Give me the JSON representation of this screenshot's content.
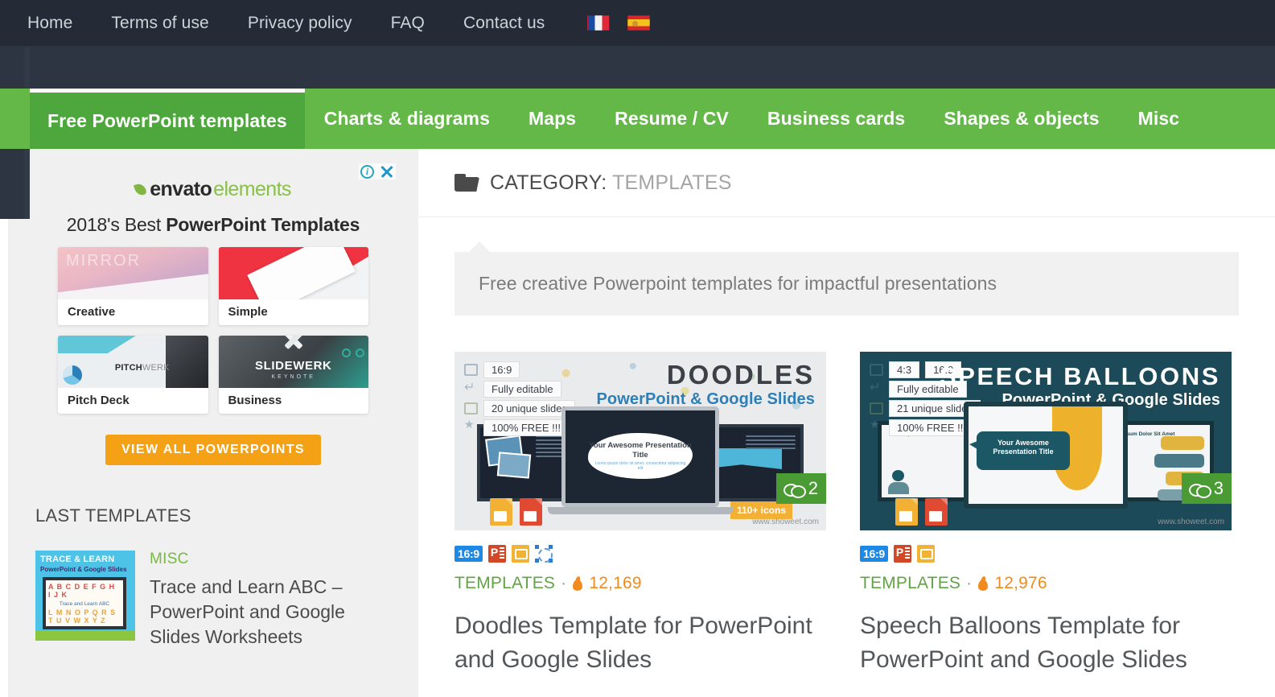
{
  "topnav": {
    "links": [
      {
        "label": "Home"
      },
      {
        "label": "Terms of use"
      },
      {
        "label": "Privacy policy"
      },
      {
        "label": "FAQ"
      },
      {
        "label": "Contact us"
      }
    ],
    "flags": [
      {
        "name": "flag-france-icon",
        "title": "Français"
      },
      {
        "name": "flag-spain-icon",
        "title": "Español"
      }
    ]
  },
  "mainmenu": {
    "items": [
      {
        "label": "Free PowerPoint templates",
        "active": true
      },
      {
        "label": "Charts & diagrams",
        "active": false
      },
      {
        "label": "Maps",
        "active": false
      },
      {
        "label": "Resume / CV",
        "active": false
      },
      {
        "label": "Business cards",
        "active": false
      },
      {
        "label": "Shapes & objects",
        "active": false
      },
      {
        "label": "Misc",
        "active": false
      }
    ],
    "active_bg": "#4da73c",
    "bar_bg": "#63b847"
  },
  "sidebar": {
    "ad": {
      "info_icon": "info-icon",
      "close_icon": "close-icon",
      "brand_first": "envato",
      "brand_second": "elements",
      "headline_prefix": "2018's Best ",
      "headline_bold": "PowerPoint Templates",
      "cards": [
        {
          "label": "Creative",
          "art_text": "MIRROR"
        },
        {
          "label": "Simple",
          "art_text": ""
        },
        {
          "label": "Pitch Deck",
          "art_text": "PITCH",
          "art_text2": "WERK"
        },
        {
          "label": "Business",
          "art_text": "SLIDEWERK",
          "art_text2": "KEYNOTE"
        }
      ],
      "cta_label": "VIEW ALL POWERPOINTS",
      "cta_color": "#f5a115"
    },
    "last_templates": {
      "heading": "LAST TEMPLATES",
      "posts": [
        {
          "category": "MISC",
          "title": "Trace and Learn ABC – PowerPoint and Google Slides Worksheets",
          "thumb_line1": "TRACE & LEARN",
          "thumb_line2": "PowerPoint & Google Slides",
          "thumb_caption": "Trace and Learn ABC",
          "thumb_letters": "A B C D E F G H I J K",
          "thumb_letters2": "L M N O P Q R S T U V W X Y Z"
        }
      ]
    }
  },
  "main": {
    "category_label": "CATEGORY:",
    "category_value": "TEMPLATES",
    "folder_icon": "folder-icon",
    "description": "Free creative Powerpoint templates for impactful presentations",
    "cards": [
      {
        "title": "Doodles Template for PowerPoint and Google Slides",
        "category": "TEMPLATES",
        "separator": "·",
        "views": "12,169",
        "comments": "2",
        "badges": [
          "16:9",
          "powerpoint-icon",
          "google-slides-icon",
          "vector-shapes-icon"
        ],
        "ratio_badge": "16:9",
        "preview": {
          "brand_line1": "DOODLES",
          "brand_line2": "PowerPoint & Google Slides",
          "specs": [
            "16:9",
            "Fully editable",
            "20 unique slides",
            "100% FREE !!!"
          ],
          "slide_title": "Your Awesome Presentation Title",
          "slide_sub": "Lorem ipsum dolor sit amet, consectetur adipiscing elit",
          "side_slide_heading": "Lorem Ipsum Dolor Sit Amet",
          "icons_tag": "110+ icons",
          "watermark": "www.showeet.com"
        }
      },
      {
        "title": "Speech Balloons Template for PowerPoint and Google Slides",
        "category": "TEMPLATES",
        "separator": "·",
        "views": "12,976",
        "comments": "3",
        "badges": [
          "16:9",
          "powerpoint-icon",
          "google-slides-icon"
        ],
        "ratio_badge": "16:9",
        "preview": {
          "brand_line1": "SPEECH BALLOONS",
          "brand_line2": "PowerPoint & Google Slides",
          "specs": [
            "4:3",
            "16:9",
            "Fully editable",
            "21 unique slides",
            "100% FREE !!!"
          ],
          "slide_title": "Your Awesome Presentation Title",
          "side_slide_heading": "Lorem Ipsum Dolor Sit Amet",
          "watermark": "www.showeet.com"
        }
      }
    ]
  }
}
